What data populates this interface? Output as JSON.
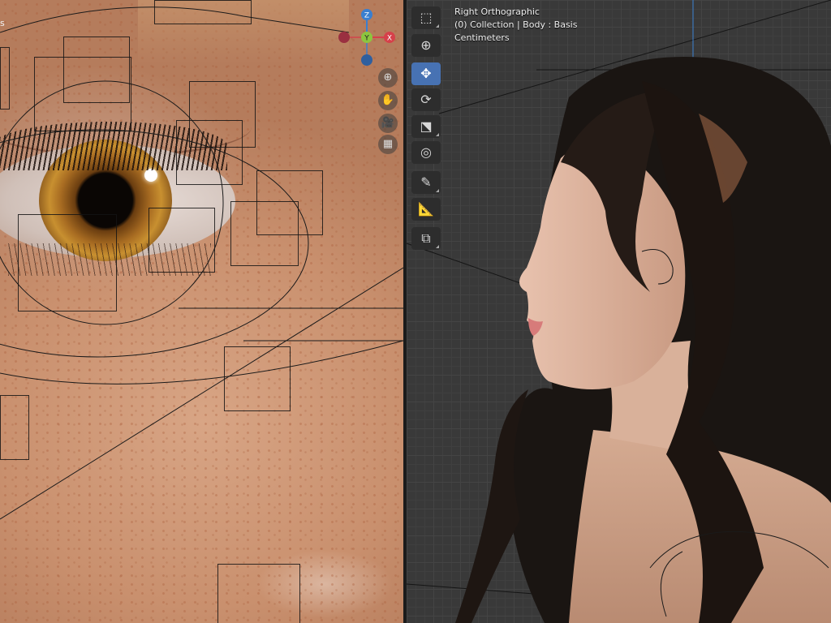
{
  "left_viewport": {
    "gizmo": {
      "z": "Z",
      "y": "Y",
      "x": "X"
    },
    "nav_buttons": [
      {
        "name": "zoom",
        "icon": "magnifier-plus-icon",
        "glyph": "⊕"
      },
      {
        "name": "pan",
        "icon": "hand-icon",
        "glyph": "✋"
      },
      {
        "name": "camera",
        "icon": "camera-icon",
        "glyph": "🎥"
      },
      {
        "name": "ortho-toggle",
        "icon": "grid-icon",
        "glyph": "▦"
      }
    ],
    "side_label": "s"
  },
  "right_viewport": {
    "view_name": "Right Orthographic",
    "collection_info": "(0) Collection | Body : Basis",
    "units": "Centimeters"
  },
  "toolbar": {
    "tools": [
      {
        "name": "select-box",
        "icon": "cursor-icon",
        "glyph": "⬚",
        "active": false
      },
      {
        "name": "cursor",
        "icon": "3d-cursor-icon",
        "glyph": "⊕",
        "active": false
      },
      {
        "name": "move",
        "icon": "move-arrows-icon",
        "glyph": "✥",
        "active": true
      },
      {
        "name": "rotate",
        "icon": "rotate-icon",
        "glyph": "⟳",
        "active": false
      },
      {
        "name": "scale",
        "icon": "scale-icon",
        "glyph": "⬔",
        "active": false
      },
      {
        "name": "transform",
        "icon": "transform-icon",
        "glyph": "◎",
        "active": false
      },
      {
        "name": "annotate",
        "icon": "pencil-icon",
        "glyph": "✎",
        "active": false
      },
      {
        "name": "measure",
        "icon": "ruler-icon",
        "glyph": "📐",
        "active": false
      },
      {
        "name": "add-cube",
        "icon": "add-cube-icon",
        "glyph": "⧉",
        "active": false
      }
    ]
  },
  "colors": {
    "axis_x": "#d6404a",
    "axis_y": "#8cc63f",
    "axis_z": "#3a7fd0",
    "active_tool": "#4772b3",
    "grid_bg": "#393939"
  }
}
